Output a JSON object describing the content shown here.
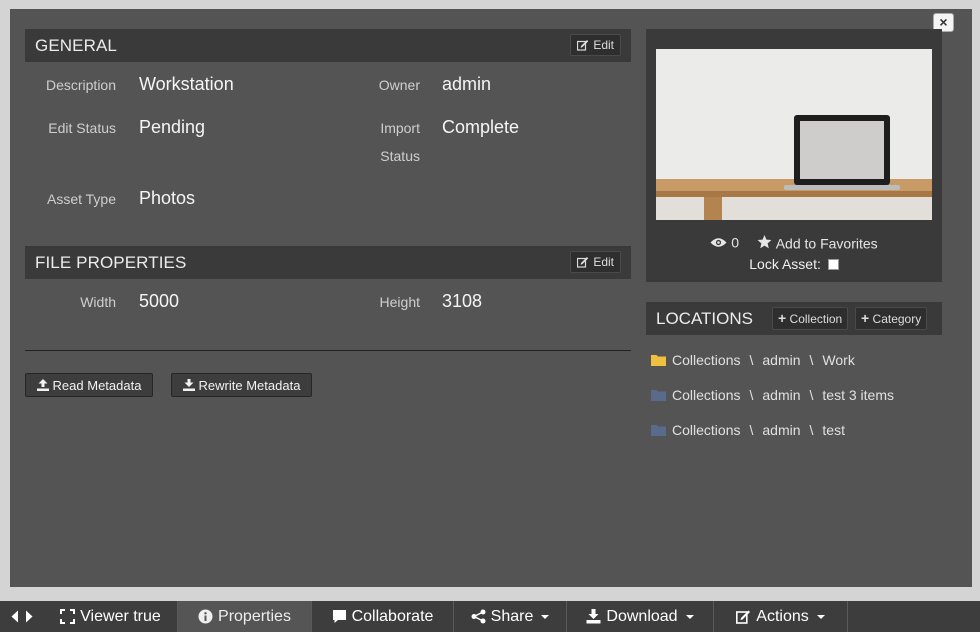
{
  "general": {
    "title": "GENERAL",
    "edit_label": "Edit",
    "fields": {
      "description_label": "Description",
      "description_value": "Workstation",
      "owner_label": "Owner",
      "owner_value": "admin",
      "edit_status_label": "Edit Status",
      "edit_status_value": "Pending",
      "import_status_label_1": "Import",
      "import_status_label_2": "Status",
      "import_status_value": "Complete",
      "asset_type_label": "Asset Type",
      "asset_type_value": "Photos"
    }
  },
  "file_properties": {
    "title": "FILE PROPERTIES",
    "edit_label": "Edit",
    "width_label": "Width",
    "width_value": "5000",
    "height_label": "Height",
    "height_value": "3108"
  },
  "metadata_buttons": {
    "read": "Read Metadata",
    "rewrite": "Rewrite Metadata"
  },
  "preview": {
    "views_count": "0",
    "favorites_label": "Add to Favorites",
    "lock_label": "Lock Asset:"
  },
  "locations": {
    "title": "LOCATIONS",
    "collection_btn": "Collection",
    "category_btn": "Category",
    "items": [
      {
        "parts": [
          "Collections",
          "admin",
          "Work"
        ],
        "folder_color": "#f0c040"
      },
      {
        "parts": [
          "Collections",
          "admin",
          "test 3 items"
        ],
        "folder_color": "#5a6a8c"
      },
      {
        "parts": [
          "Collections",
          "admin",
          "test"
        ],
        "folder_color": "#5a6a8c"
      }
    ],
    "separator": "\\"
  },
  "bottom_tabs": {
    "viewer": "Viewer true",
    "properties": "Properties",
    "collaborate": "Collaborate",
    "share": "Share",
    "download": "Download",
    "actions": "Actions"
  },
  "close_label": "×"
}
